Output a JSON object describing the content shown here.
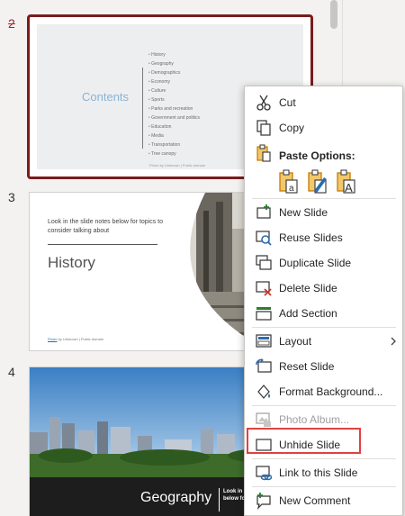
{
  "slides": [
    {
      "number": "2",
      "hidden": true,
      "title": "Contents",
      "items": [
        "History",
        "Geography",
        "Demographics",
        "Economy",
        "Culture",
        "Sports",
        "Parks and recreation",
        "Government and politics",
        "Education",
        "Media",
        "Transportation",
        "Tree canopy"
      ],
      "credit": "Photo by Unknown | Public domain"
    },
    {
      "number": "3",
      "note": "Look in the slide notes below for topics to consider talking about",
      "title": "History",
      "credit_link": "Photo",
      "credit_rest": " by Unknown | Public domain"
    },
    {
      "number": "4",
      "title": "Geography",
      "note": "Look in the slide notes below for topics to consider"
    }
  ],
  "menu": {
    "cut": "Cut",
    "copy": "Copy",
    "paste_options": "Paste Options:",
    "new_slide": "New Slide",
    "reuse_slides": "Reuse Slides",
    "duplicate_slide": "Duplicate Slide",
    "delete_slide": "Delete Slide",
    "add_section": "Add Section",
    "layout": "Layout",
    "reset_slide": "Reset Slide",
    "format_background": "Format Background...",
    "photo_album": "Photo Album...",
    "unhide_slide": "Unhide Slide",
    "link_to_slide": "Link to this Slide",
    "new_comment": "New Comment"
  },
  "colors": {
    "selected_border": "#7a1c1c",
    "highlight": "#e04141",
    "icon_green": "#2e7d32",
    "icon_blue": "#2b6cb0",
    "icon_red": "#c0392b",
    "icon_gold": "#c57a00"
  },
  "icons": [
    "scissors-icon",
    "copy-icon",
    "paste-icon",
    "paste-keep-source-icon",
    "paste-picture-icon",
    "paste-text-only-icon",
    "new-slide-icon",
    "reuse-slides-icon",
    "duplicate-slide-icon",
    "delete-slide-icon",
    "add-section-icon",
    "layout-icon",
    "reset-slide-icon",
    "format-background-icon",
    "photo-album-icon",
    "unhide-slide-icon",
    "link-icon",
    "new-comment-icon",
    "chevron-right-icon"
  ]
}
